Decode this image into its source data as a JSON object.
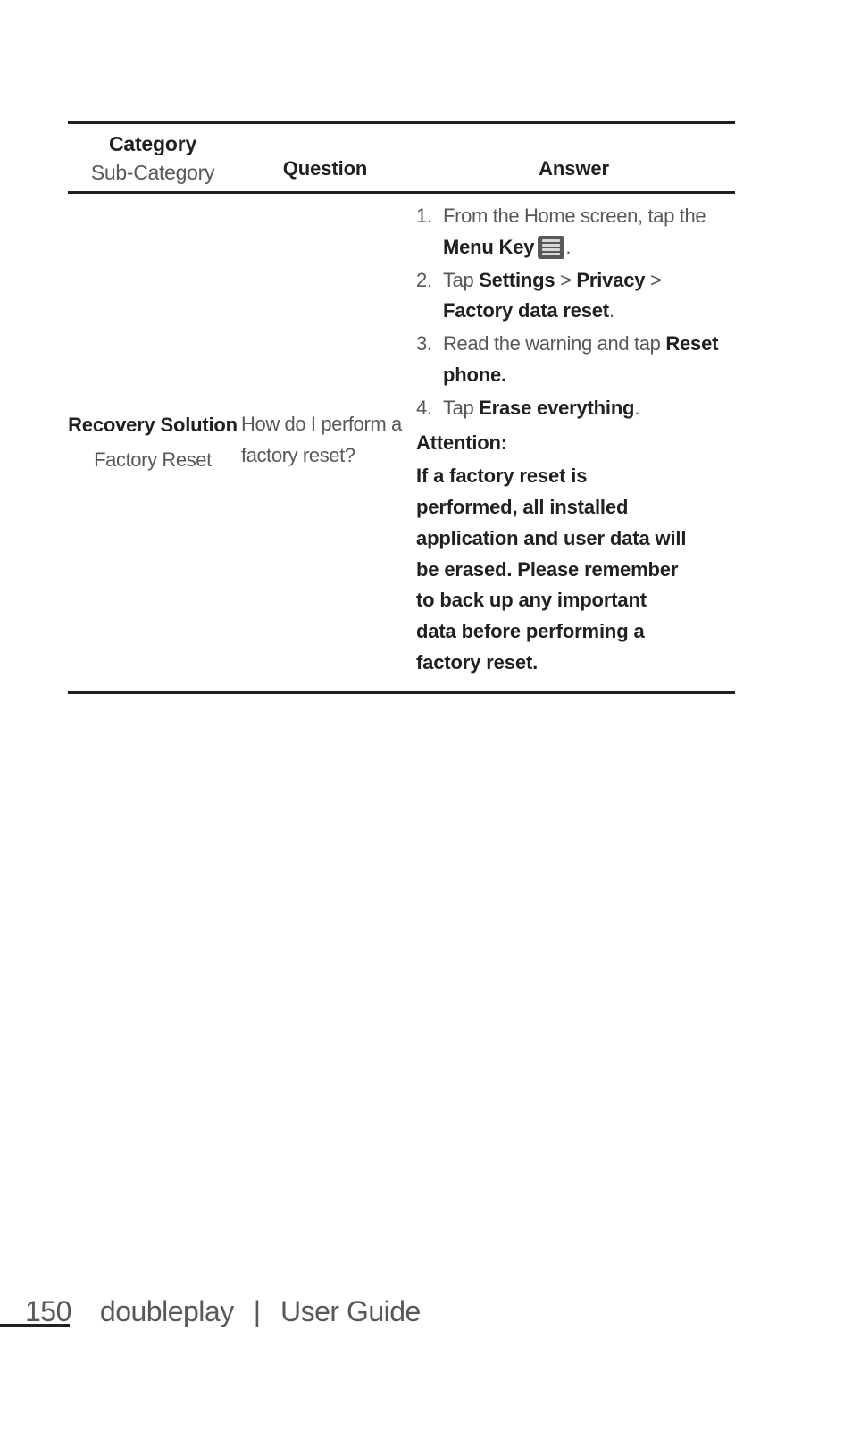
{
  "table": {
    "headers": {
      "category": "Category",
      "sub_category": "Sub-Category",
      "question": "Question",
      "answer": "Answer"
    },
    "row": {
      "category": "Recovery Solution",
      "sub_category": "Factory Reset",
      "question": "How do I perform a factory reset?",
      "answer": {
        "steps": [
          {
            "num": "1.",
            "parts": [
              {
                "type": "text",
                "value": "From the Home screen, tap the "
              },
              {
                "type": "bold",
                "value": "Menu Key"
              },
              {
                "type": "icon",
                "value": "menu-key-icon"
              },
              {
                "type": "text",
                "value": "."
              }
            ]
          },
          {
            "num": "2.",
            "parts": [
              {
                "type": "text",
                "value": "Tap "
              },
              {
                "type": "bold",
                "value": "Settings"
              },
              {
                "type": "text",
                "value": " > "
              },
              {
                "type": "bold",
                "value": "Privacy"
              },
              {
                "type": "text",
                "value": " > "
              },
              {
                "type": "bold",
                "value": "Factory data reset"
              },
              {
                "type": "text",
                "value": "."
              }
            ]
          },
          {
            "num": "3.",
            "parts": [
              {
                "type": "text",
                "value": "Read the warning and tap "
              },
              {
                "type": "bold",
                "value": "Reset phone."
              }
            ]
          },
          {
            "num": "4.",
            "parts": [
              {
                "type": "text",
                "value": "Tap "
              },
              {
                "type": "bold",
                "value": "Erase everything"
              },
              {
                "type": "text",
                "value": "."
              }
            ]
          }
        ],
        "attention_heading": "Attention:",
        "attention_body": "If a factory reset is performed, all installed application and user data will be erased. Please remember to back up any important data before performing a factory reset."
      }
    }
  },
  "footer": {
    "page_number": "150",
    "product": "doubleplay",
    "separator": "|",
    "document": "User Guide"
  },
  "colors": {
    "rule": "#231f20",
    "body_text": "#58585a",
    "bold_text": "#231f20",
    "icon_fill": "#58585a",
    "icon_lines": "#d9d9d9"
  }
}
